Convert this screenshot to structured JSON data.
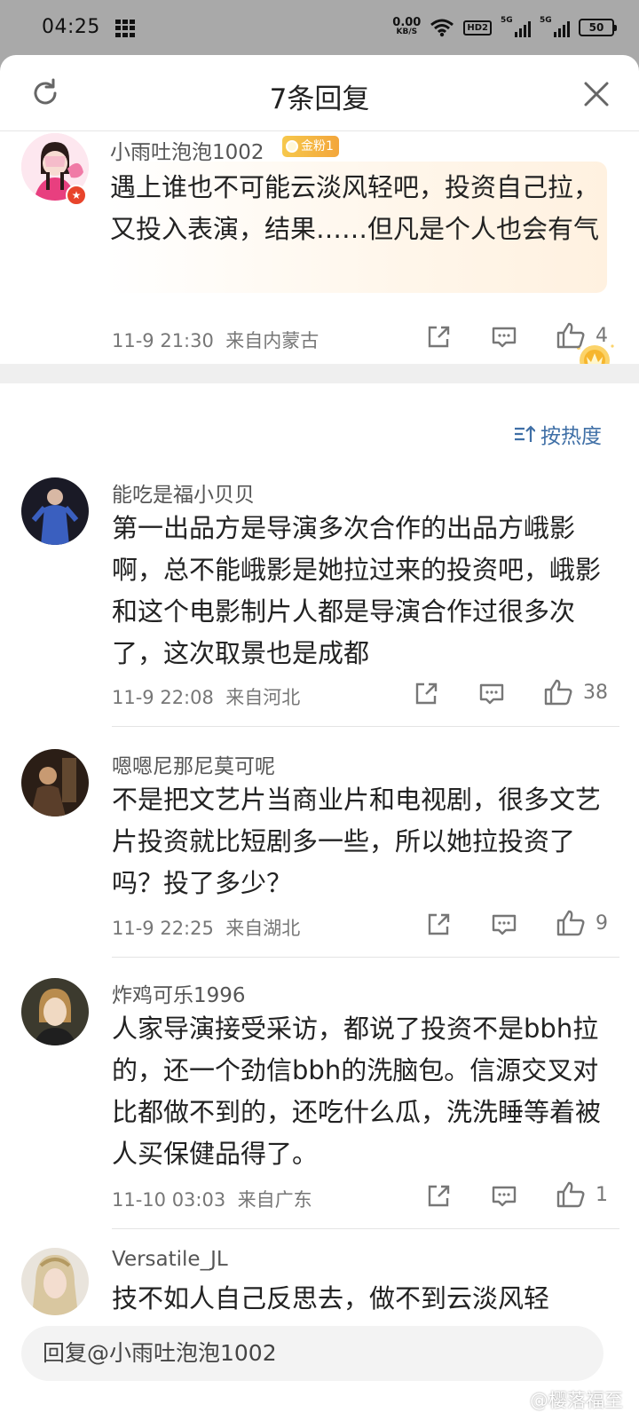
{
  "status_bar": {
    "time": "04:25",
    "net_speed": "0.00",
    "net_unit": "KB/S",
    "hd_label": "HD2",
    "signal1_label": "5G",
    "signal2_label": "5G",
    "battery": "50"
  },
  "sheet": {
    "title": "7条回复",
    "icons": {
      "refresh": "refresh-icon",
      "close": "close-icon"
    }
  },
  "original_comment": {
    "username": "小雨吐泡泡1002",
    "badge": "金粉1",
    "text": "遇上谁也不可能云淡风轻吧，投资自己拉，又投入表演，结果……但凡是个人也会有气",
    "time": "11-9 21:30",
    "location": "来自内蒙古",
    "likes": "4"
  },
  "sort_label": "按热度",
  "replies": [
    {
      "username": "能吃是福小贝贝",
      "text": "第一出品方是导演多次合作的出品方峨影啊，总不能峨影是她拉过来的投资吧，峨影和这个电影制片人都是导演合作过很多次了，这次取景也是成都",
      "time": "11-9 22:08",
      "location": "来自河北",
      "likes": "38"
    },
    {
      "username": "嗯嗯尼那尼莫可呢",
      "text": "不是把文艺片当商业片和电视剧，很多文艺片投资就比短剧多一些，所以她拉投资了吗？投了多少？",
      "time": "11-9 22:25",
      "location": "来自湖北",
      "likes": "9"
    },
    {
      "username": "炸鸡可乐1996",
      "text": "人家导演接受采访，都说了投资不是bbh拉的，还一个劲信bbh的洗脑包。信源交叉对比都做不到的，还吃什么瓜，洗洗睡等着被人买保健品得了。",
      "time": "11-10 03:03",
      "location": "来自广东",
      "likes": "1"
    },
    {
      "username": "Versatile_JL",
      "text": "技不如人自己反思去，做不到云淡风轻",
      "time": "",
      "location": "",
      "likes": ""
    }
  ],
  "reply_input": {
    "placeholder": "回复@小雨吐泡泡1002"
  },
  "watermark": "@樱落福至",
  "colors": {
    "link_blue": "#3f6fa6",
    "badge_gold": "#f3b53f",
    "vip_red": "#e8442b"
  }
}
